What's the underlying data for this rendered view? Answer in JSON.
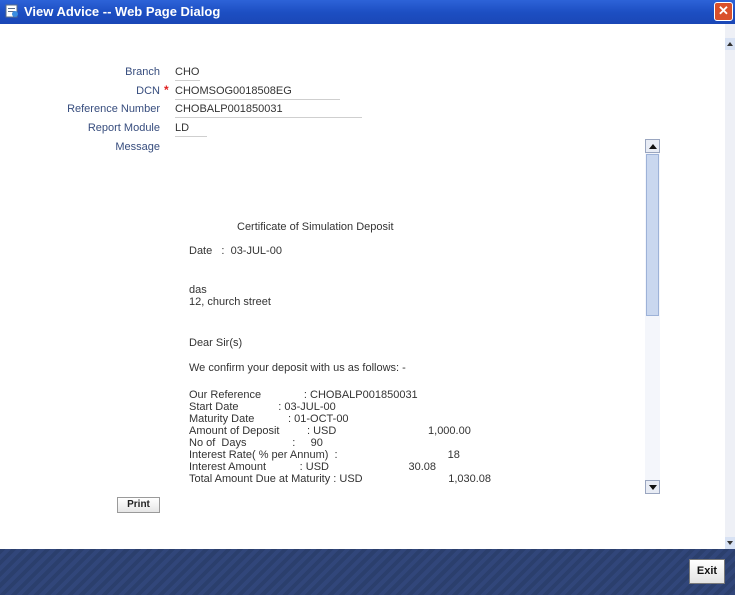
{
  "window": {
    "title": "View Advice -- Web Page Dialog",
    "close_symbol": "✕"
  },
  "form": {
    "branch_label": "Branch",
    "branch_value": "CHO",
    "dcn_label": "DCN",
    "dcn_required": "*",
    "dcn_value": "CHOMSOG0018508EG",
    "reference_label": "Reference Number",
    "reference_value": "CHOBALP001850031",
    "module_label": "Report Module",
    "module_value": "LD",
    "message_label": "Message"
  },
  "message_lines": [
    "Certificate of Simulation Deposit",
    "Date   :  03-JUL-00",
    "das",
    "12, church street",
    "Dear Sir(s)",
    "We confirm your deposit with us as follows: -",
    "Our Reference              : CHOBALP001850031",
    "Start Date             : 03-JUL-00",
    "Maturity Date           : 01-OCT-00",
    "Amount of Deposit         : USD                              1,000.00",
    "No of  Days               :     90",
    "Interest Rate( % per Annum)  :                                    18",
    "Interest Amount           : USD                          30.08",
    "Total Amount Due at Maturity : USD                            1,030.08"
  ],
  "buttons": {
    "print": "Print",
    "exit": "Exit"
  },
  "colors": {
    "titlebar": "#1d4fc3",
    "footer": "#2b3f6d",
    "label": "#374d7e",
    "required": "#e02020"
  }
}
